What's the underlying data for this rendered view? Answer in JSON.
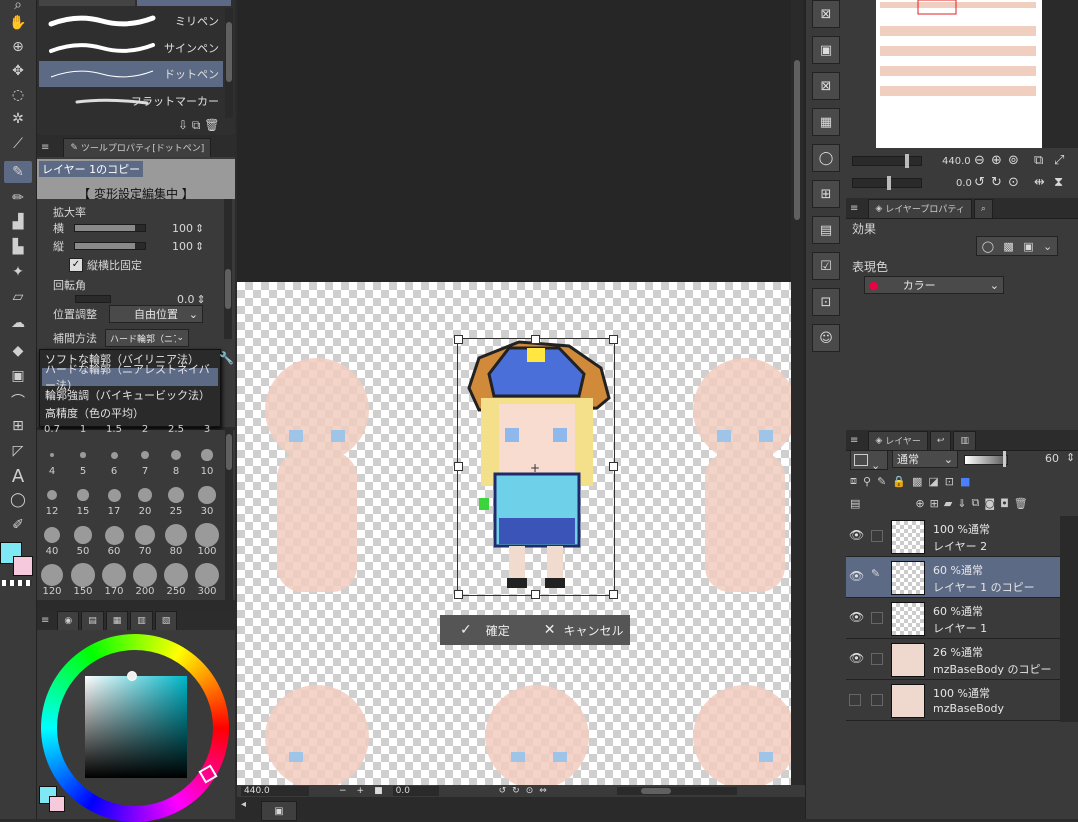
{
  "brushes": {
    "items": [
      {
        "label": "ミリペン"
      },
      {
        "label": "サインペン"
      },
      {
        "label": "ドットペン"
      },
      {
        "label": "フラットマーカー"
      }
    ]
  },
  "tool_property": {
    "tab_label": "ツールプロパティ[ドットペン]",
    "layer_label": "レイヤー 1のコピー",
    "mode_label": "【 変形設定編集中 】",
    "scale_label": "拡大率",
    "h_label": "横",
    "h_value": "100",
    "v_label": "縦",
    "v_value": "100",
    "keep_ratio_label": "縦横比固定",
    "rotation_label": "回転角",
    "rotation_value": "0.0",
    "position_label": "位置調整",
    "position_value": "自由位置",
    "interp_label": "補間方法",
    "interp_value": "ハード輪郭（ニアレストネ",
    "interp_options": [
      "ソフトな輪郭（バイリニア法）",
      "ハードな輪郭（ニアレストネイバー法）",
      "輪郭強調（バイキュービック法）",
      "高精度（色の平均）"
    ]
  },
  "brush_sizes": {
    "top_row": [
      "0.7",
      "1",
      "1.5",
      "2",
      "2.5",
      "3"
    ],
    "rows": [
      [
        "4",
        "5",
        "6",
        "7",
        "8",
        "10"
      ],
      [
        "12",
        "15",
        "17",
        "20",
        "25",
        "30"
      ],
      [
        "40",
        "50",
        "60",
        "70",
        "80",
        "100"
      ],
      [
        "120",
        "150",
        "170",
        "200",
        "250",
        "300"
      ]
    ]
  },
  "canvas": {
    "confirm_label": "確定",
    "cancel_label": "キャンセル",
    "zoom_value": "440.0",
    "rotate_value": "0.0"
  },
  "navigator": {
    "zoom_value": "440.0",
    "angle_value": "0.0"
  },
  "layer_property": {
    "tab_label": "レイヤープロパティ",
    "effect_label": "効果",
    "color_label": "表現色",
    "color_value": "カラー"
  },
  "layers_panel": {
    "tab_label": "レイヤー",
    "blend_mode": "通常",
    "opacity": "60",
    "layers": [
      {
        "mode": "100 %通常",
        "name": "レイヤー 2",
        "visible": true
      },
      {
        "mode": "60 %通常",
        "name": "レイヤー 1 のコピー",
        "visible": true
      },
      {
        "mode": "60 %通常",
        "name": "レイヤー 1",
        "visible": true
      },
      {
        "mode": "26 %通常",
        "name": "mzBaseBody のコピー",
        "visible": true
      },
      {
        "mode": "100 %通常",
        "name": "mzBaseBody",
        "visible": false
      }
    ]
  },
  "colors": {
    "accent": "#5d6a86",
    "main_color": "#7fe8f5",
    "sub_color": "#f6c9dc"
  }
}
